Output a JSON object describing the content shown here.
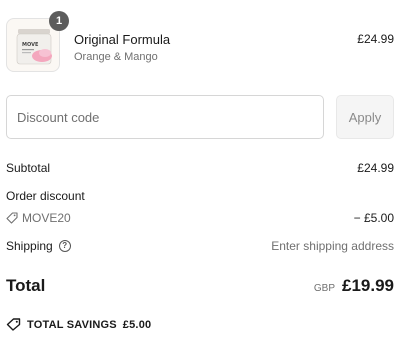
{
  "product": {
    "quantity": "1",
    "name": "Original Formula",
    "variant": "Orange & Mango",
    "price": "£24.99",
    "jar_label": "MOVE"
  },
  "discount": {
    "placeholder": "Discount code",
    "apply_label": "Apply"
  },
  "summary": {
    "subtotal_label": "Subtotal",
    "subtotal_value": "£24.99",
    "order_discount_label": "Order discount",
    "discount_code": "MOVE20",
    "discount_value": "− £5.00",
    "shipping_label": "Shipping",
    "shipping_help_icon": "?",
    "shipping_value": "Enter shipping address",
    "total_label": "Total",
    "currency": "GBP",
    "total_value": "£19.99"
  },
  "savings": {
    "label": "TOTAL SAVINGS",
    "value": "£5.00"
  },
  "colors": {
    "badge": "#5c5c5c",
    "muted_text": "#707070",
    "border": "#d6d6d6"
  }
}
